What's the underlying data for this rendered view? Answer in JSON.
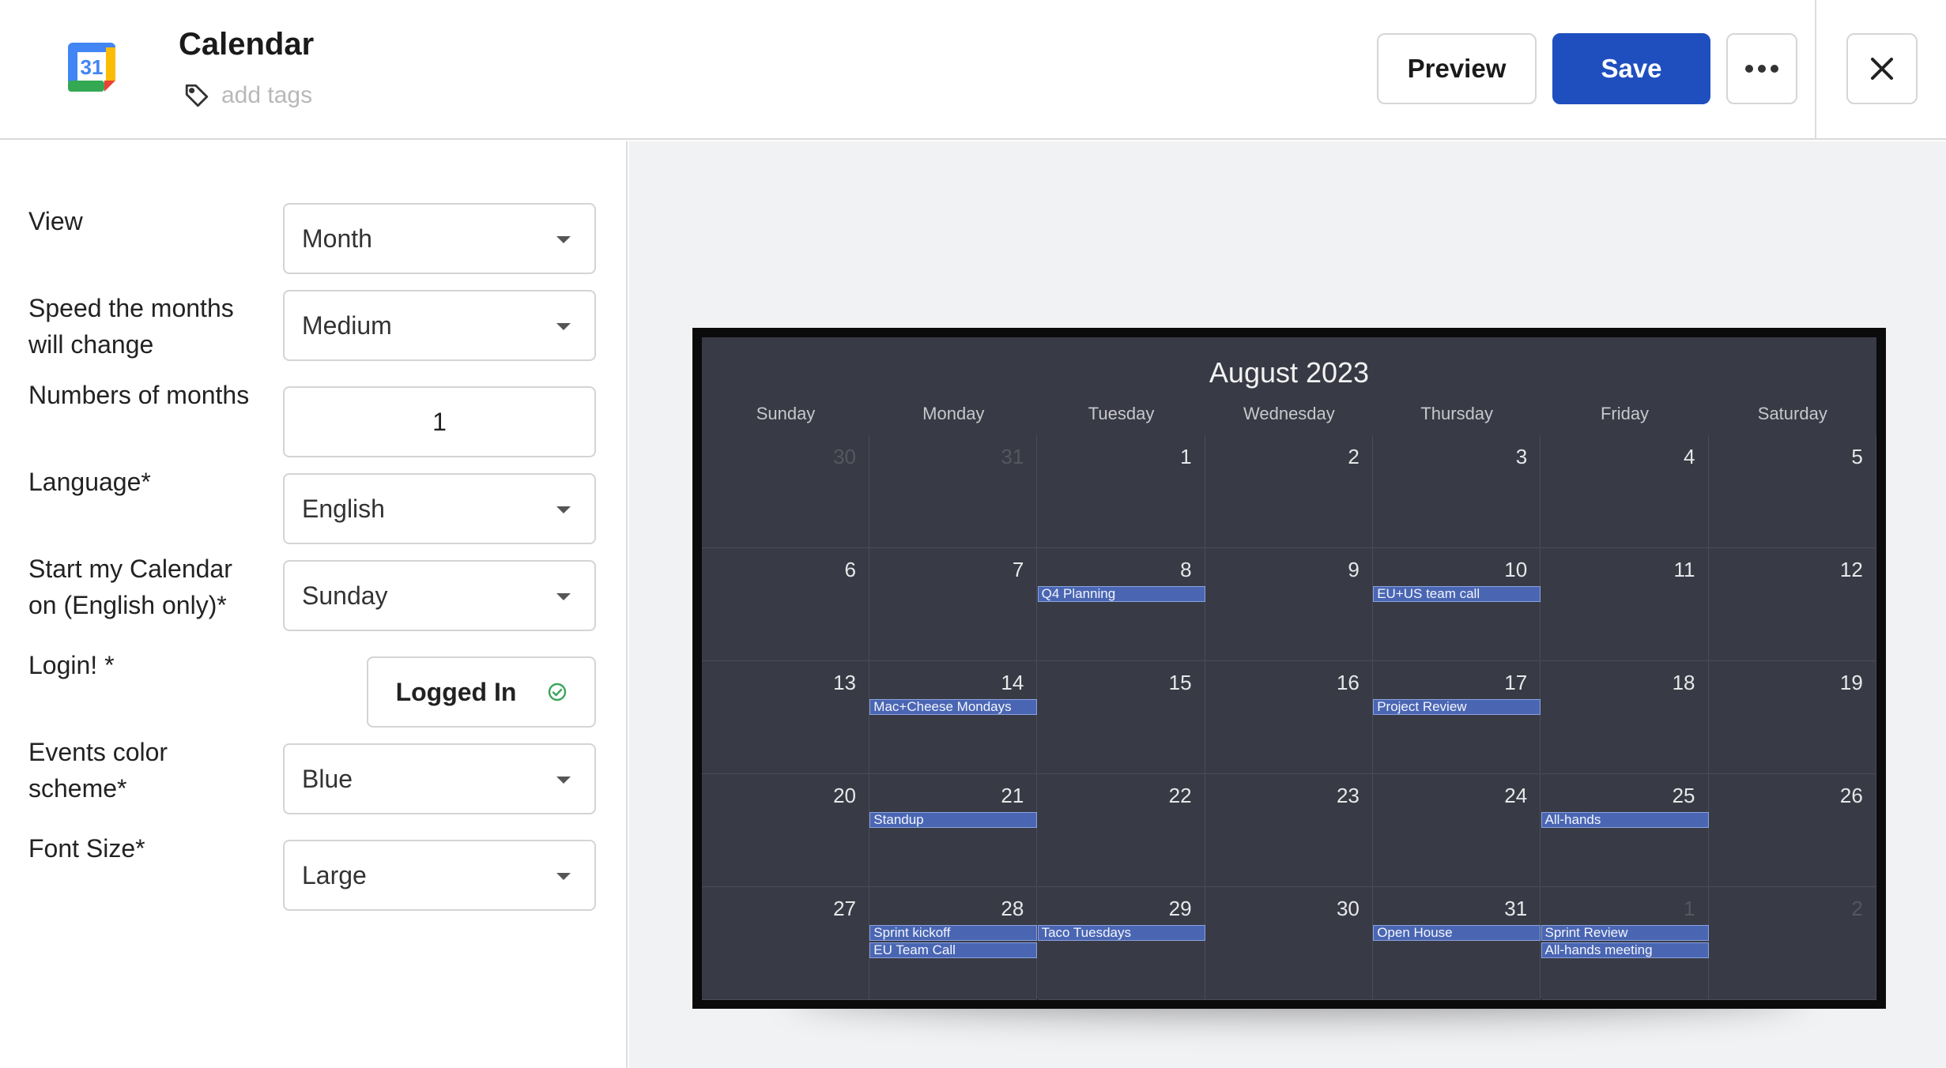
{
  "header": {
    "title": "Calendar",
    "app_icon": "google-calendar-icon",
    "app_icon_text": "31",
    "tags_placeholder": "add tags",
    "preview_label": "Preview",
    "save_label": "Save",
    "more_icon": "more-horizontal-icon",
    "close_icon": "close-icon"
  },
  "settings": {
    "view": {
      "label": "View",
      "value": "Month"
    },
    "speed": {
      "label": "Speed the months will change",
      "value": "Medium"
    },
    "months": {
      "label": "Numbers of months",
      "value": "1"
    },
    "language": {
      "label": "Language*",
      "value": "English"
    },
    "start_day": {
      "label": "Start my Calendar on (English only)*",
      "value": "Sunday"
    },
    "login": {
      "label": "Login! *",
      "value": "Logged In",
      "status_icon": "check-circle-icon"
    },
    "color_scheme": {
      "label": "Events color scheme*",
      "value": "Blue"
    },
    "font_size": {
      "label": "Font Size*",
      "value": "Large"
    }
  },
  "calendar": {
    "title": "August 2023",
    "weekdays": [
      "Sunday",
      "Monday",
      "Tuesday",
      "Wednesday",
      "Thursday",
      "Friday",
      "Saturday"
    ],
    "weeks": [
      [
        {
          "d": "30",
          "dim": true
        },
        {
          "d": "31",
          "dim": true
        },
        {
          "d": "1"
        },
        {
          "d": "2"
        },
        {
          "d": "3"
        },
        {
          "d": "4"
        },
        {
          "d": "5"
        }
      ],
      [
        {
          "d": "6"
        },
        {
          "d": "7"
        },
        {
          "d": "8",
          "events": [
            "Q4 Planning"
          ]
        },
        {
          "d": "9"
        },
        {
          "d": "10",
          "events": [
            "EU+US team call"
          ]
        },
        {
          "d": "11"
        },
        {
          "d": "12"
        }
      ],
      [
        {
          "d": "13"
        },
        {
          "d": "14",
          "events": [
            "Mac+Cheese Mondays"
          ]
        },
        {
          "d": "15"
        },
        {
          "d": "16"
        },
        {
          "d": "17",
          "events": [
            "Project Review"
          ]
        },
        {
          "d": "18"
        },
        {
          "d": "19"
        }
      ],
      [
        {
          "d": "20"
        },
        {
          "d": "21",
          "events": [
            "Standup"
          ]
        },
        {
          "d": "22"
        },
        {
          "d": "23"
        },
        {
          "d": "24"
        },
        {
          "d": "25",
          "events": [
            "All-hands"
          ]
        },
        {
          "d": "26"
        }
      ],
      [
        {
          "d": "27"
        },
        {
          "d": "28",
          "events": [
            "Sprint kickoff",
            "EU Team Call"
          ]
        },
        {
          "d": "29",
          "events": [
            "Taco Tuesdays"
          ]
        },
        {
          "d": "30"
        },
        {
          "d": "31",
          "events": [
            "Open House"
          ]
        },
        {
          "d": "1",
          "dim": true,
          "events": [
            "Sprint Review",
            "All-hands meeting"
          ]
        },
        {
          "d": "2",
          "dim": true
        }
      ]
    ]
  },
  "colors": {
    "save_button": "#1f4fbf",
    "calendar_bg": "#383a45",
    "event_bg": "#4a66b3",
    "logged_in_check": "#3aa55a"
  }
}
